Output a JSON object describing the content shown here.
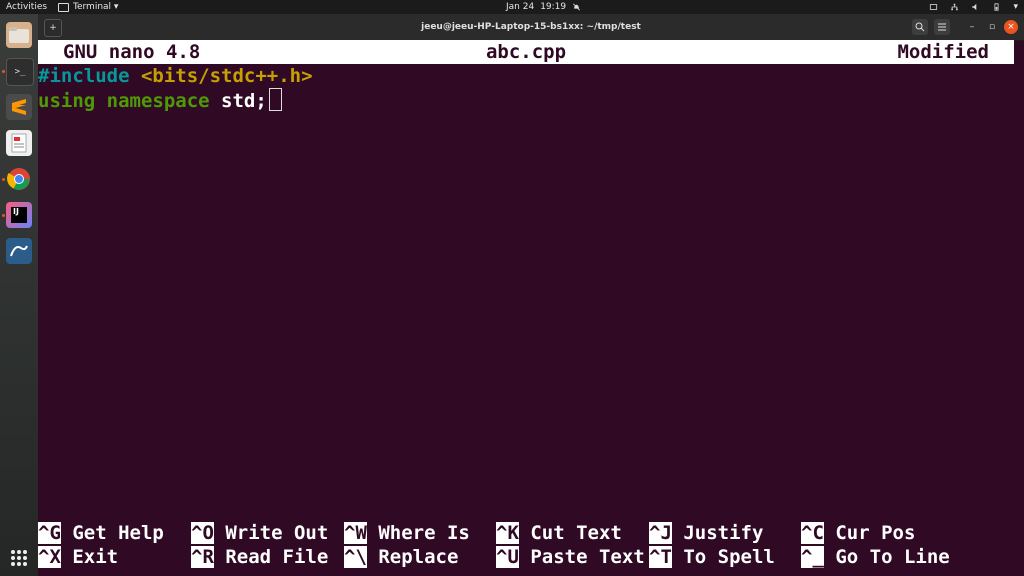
{
  "topbar": {
    "activities": "Activities",
    "app_menu": "Terminal ▾",
    "date": "Jan 24",
    "time": "19:19"
  },
  "window": {
    "title": "jeeu@jeeu-HP-Laptop-15-bs1xx: ~/tmp/test"
  },
  "nano": {
    "version": "GNU nano 4.8",
    "filename": "abc.cpp",
    "status": "Modified",
    "lines": [
      {
        "pre": "#include",
        "inc": " <bits/stdc++.h>"
      },
      {
        "kw1": "using",
        "kw2": " namespace",
        "rest": " std;"
      }
    ],
    "shortcuts": [
      {
        "key": "^G",
        "label": " Get Help"
      },
      {
        "key": "^O",
        "label": " Write Out"
      },
      {
        "key": "^W",
        "label": " Where Is"
      },
      {
        "key": "^K",
        "label": " Cut Text"
      },
      {
        "key": "^J",
        "label": " Justify"
      },
      {
        "key": "^C",
        "label": " Cur Pos"
      },
      {
        "key": "^X",
        "label": " Exit"
      },
      {
        "key": "^R",
        "label": " Read File"
      },
      {
        "key": "^\\",
        "label": " Replace"
      },
      {
        "key": "^U",
        "label": " Paste Text"
      },
      {
        "key": "^T",
        "label": " To Spell"
      },
      {
        "key": "^_",
        "label": " Go To Line"
      }
    ]
  },
  "dock": {
    "items": [
      "files-icon",
      "terminal-icon",
      "sublime-text-icon",
      "document-viewer-icon",
      "chrome-icon",
      "intellij-icon",
      "mysql-workbench-icon"
    ]
  },
  "colors": {
    "terminal_bg": "#300a24",
    "accent": "#e95420"
  }
}
